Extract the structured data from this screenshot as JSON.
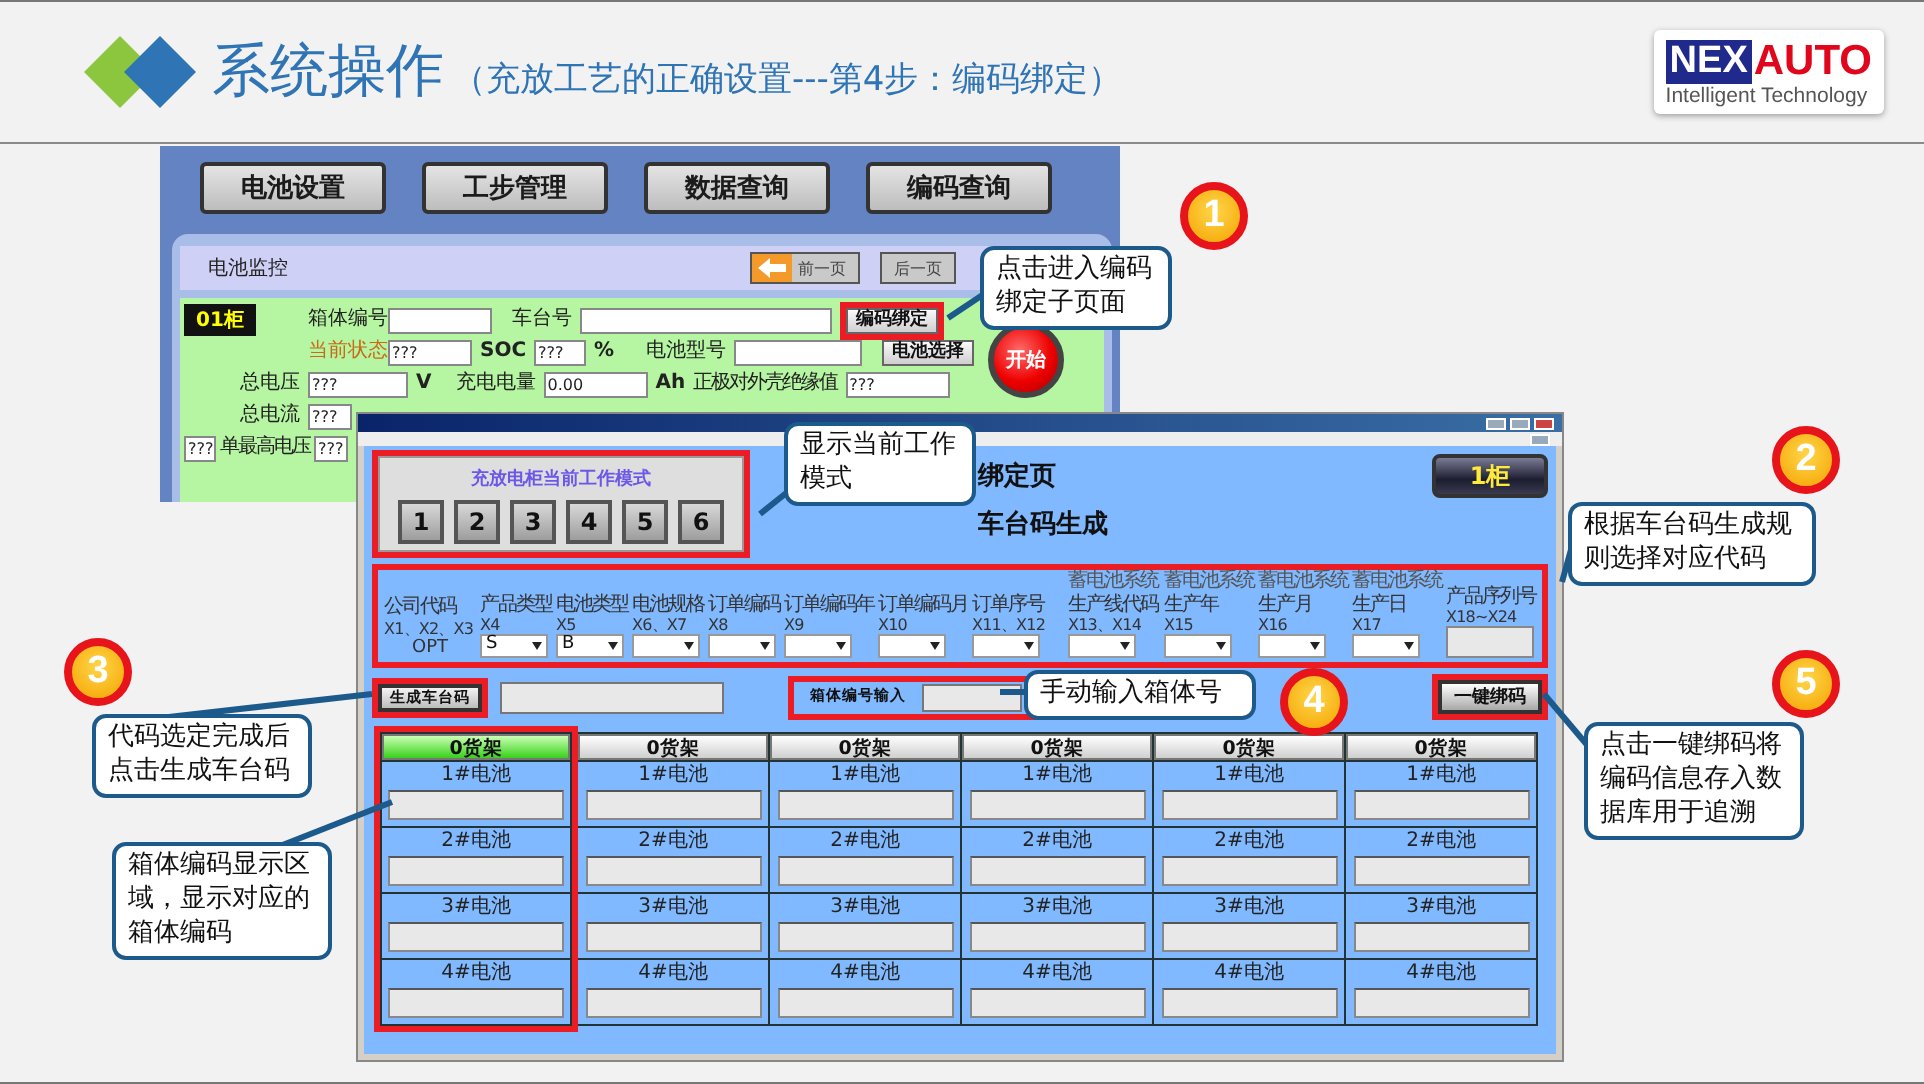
{
  "header": {
    "title": "系统操作",
    "subtitle": "（充放工艺的正确设置---第4步：编码绑定）",
    "logo": {
      "mark": "NEX",
      "word": "AUTO",
      "tagline": "Intelligent Technology"
    }
  },
  "main_app": {
    "tabs": [
      "电池设置",
      "工步管理",
      "数据查询",
      "编码查询"
    ],
    "panel_title": "电池监控",
    "prev_button": "前一页",
    "next_button": "后一页",
    "cabinet": {
      "label": "01柜",
      "box_no_label": "箱体编号",
      "car_no_label": "车台号",
      "bind_button": "编码绑定",
      "status_label": "当前状态",
      "status_value": "???",
      "soc_label": "SOC",
      "soc_value": "???",
      "soc_unit": "%",
      "model_label": "电池型号",
      "select_button": "电池选择",
      "voltage_label": "总电压",
      "voltage_value": "???",
      "voltage_unit": "V",
      "charge_label": "充电电量",
      "charge_value": "0.00",
      "charge_unit": "Ah",
      "insulation_label": "正极对外壳绝缘值",
      "insulation_value": "???",
      "start_button": "开始",
      "current_label": "总电流",
      "current_value": "???",
      "cell_index": "???",
      "max_cell_label": "单最高电压",
      "max_cell_value": "???"
    }
  },
  "popup": {
    "mode_title": "充放电柜当前工作模式",
    "modes": [
      "1",
      "2",
      "3",
      "4",
      "5",
      "6"
    ],
    "page_title": "绑定页",
    "section_title": "车台码生成",
    "cabinet_button": "1柜",
    "code_fields": [
      {
        "name": "公司代码",
        "code": "X1、X2、X3",
        "kind": "fixed",
        "value": "OPT"
      },
      {
        "name": "产品类型",
        "code": "X4",
        "kind": "select",
        "value": "S"
      },
      {
        "name": "电池类型",
        "code": "X5",
        "kind": "select",
        "value": "B"
      },
      {
        "name": "电池规格",
        "code": "X6、X7",
        "kind": "select"
      },
      {
        "name": "订单编码",
        "code": "X8",
        "kind": "select"
      },
      {
        "name": "订单编码年",
        "code": "X9",
        "kind": "select"
      },
      {
        "name": "订单编码月",
        "code": "X10",
        "kind": "select"
      },
      {
        "name": "订单序号",
        "code": "X11、X12",
        "kind": "select"
      },
      {
        "group": "蓄电池系统",
        "name": "生产线代码",
        "code": "X13、X14",
        "kind": "select"
      },
      {
        "group": "蓄电池系统",
        "name": "生产年",
        "code": "X15",
        "kind": "select"
      },
      {
        "group": "蓄电池系统",
        "name": "生产月",
        "code": "X16",
        "kind": "select"
      },
      {
        "group": "蓄电池系统",
        "name": "生产日",
        "code": "X17",
        "kind": "select"
      },
      {
        "name": "产品序列号",
        "code": "X18~X24",
        "kind": "input"
      }
    ],
    "generate_button": "生成车台码",
    "box_input_label": "箱体编号输入",
    "bind_all_button": "一键绑码",
    "shelves": [
      {
        "label": "0货架",
        "selected": true,
        "batteries": [
          "1#电池",
          "2#电池",
          "3#电池",
          "4#电池"
        ]
      },
      {
        "label": "0货架",
        "selected": false,
        "batteries": [
          "1#电池",
          "2#电池",
          "3#电池",
          "4#电池"
        ]
      },
      {
        "label": "0货架",
        "selected": false,
        "batteries": [
          "1#电池",
          "2#电池",
          "3#电池",
          "4#电池"
        ]
      },
      {
        "label": "0货架",
        "selected": false,
        "batteries": [
          "1#电池",
          "2#电池",
          "3#电池",
          "4#电池"
        ]
      },
      {
        "label": "0货架",
        "selected": false,
        "batteries": [
          "1#电池",
          "2#电池",
          "3#电池",
          "4#电池"
        ]
      },
      {
        "label": "0货架",
        "selected": false,
        "batteries": [
          "1#电池",
          "2#电池",
          "3#电池",
          "4#电池"
        ]
      }
    ]
  },
  "callouts": [
    {
      "number": "1",
      "text": "点击进入编码绑定子页面"
    },
    {
      "text": "显示当前工作模式"
    },
    {
      "number": "2",
      "text": "根据车台码生成规则选择对应代码"
    },
    {
      "number": "3",
      "text": "代码选定完成后点击生成车台码"
    },
    {
      "number": "4",
      "text": "手动输入箱体号"
    },
    {
      "number": "5",
      "text": "点击一键绑码将编码信息存入数据库用于追溯"
    },
    {
      "text": "箱体编码显示区域，显示对应的箱体编码"
    }
  ]
}
